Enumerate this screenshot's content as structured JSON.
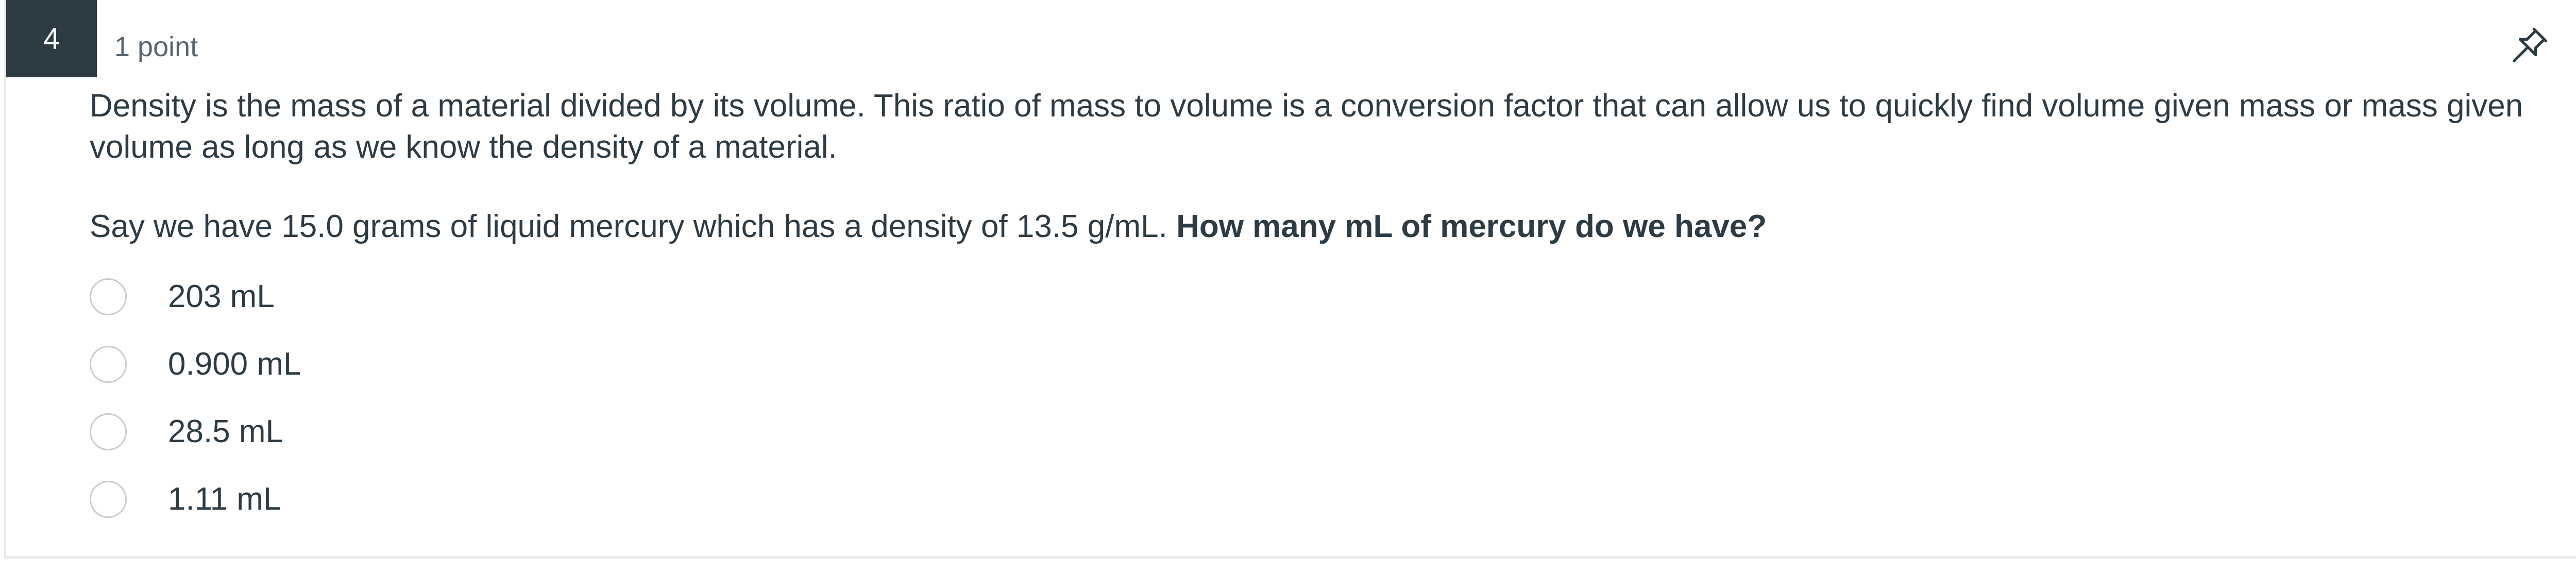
{
  "question": {
    "number": "4",
    "points": "1 point",
    "pin_icon": "pin-icon",
    "paragraph1": "Density is the mass of a material divided by its volume. This ratio of mass to volume is a conversion factor that can allow us to quickly find volume given mass or mass given volume as long as we know the density of a material.",
    "paragraph2_normal": "Say we have 15.0 grams of liquid mercury which has a density of 13.5 g/mL. ",
    "paragraph2_bold": "How many mL of mercury do we have?",
    "answers": [
      {
        "label": "203 mL"
      },
      {
        "label": "0.900 mL"
      },
      {
        "label": "28.5 mL"
      },
      {
        "label": "1.11 mL"
      }
    ]
  },
  "colors": {
    "number_badge_bg": "#2d3b45",
    "text": "#2d3b45",
    "muted_text": "#56656f",
    "radio_border": "#c7cdd1",
    "card_border": "#e8eaec"
  }
}
